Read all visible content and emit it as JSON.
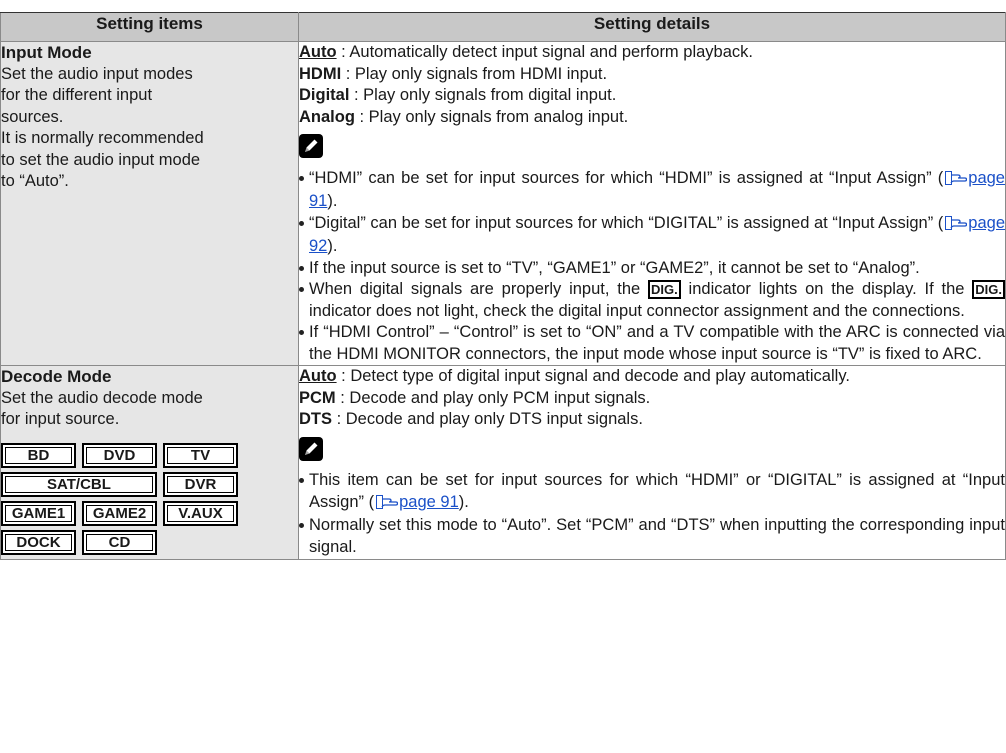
{
  "header": {
    "col1": "Setting items",
    "col2": "Setting details"
  },
  "input_mode": {
    "title": "Input Mode",
    "desc_lines": [
      "Set the audio input modes",
      "for the different input",
      "sources.",
      "It is normally recommended",
      "to set the audio input mode",
      "to “Auto”."
    ],
    "options": [
      {
        "name": "Auto",
        "desc": " : Automatically detect input signal and perform playback."
      },
      {
        "name": "HDMI",
        "desc": " : Play only signals from HDMI input."
      },
      {
        "name": "Digital",
        "desc": " : Play only signals from digital input."
      },
      {
        "name": "Analog",
        "desc": " : Play only signals from analog input."
      }
    ],
    "notes": {
      "n1_pre": "“HDMI” can be set for input sources for which “HDMI” is assigned at “Input Assign” (",
      "n1_link": "page 91",
      "n1_post": ").",
      "n2_pre": "“Digital” can be set for input sources for which “DIGITAL” is assigned at “Input Assign” (",
      "n2_link": "page 92",
      "n2_post": ").",
      "n3": "If the input source is set to “TV”, “GAME1” or “GAME2”, it cannot be set to “Analog”.",
      "n4_a": "When digital signals are properly input, the ",
      "n4_ind1": "DIG.",
      "n4_b": " indicator lights on the display. If the ",
      "n4_ind2": "DIG.",
      "n4_c": " indicator does not light, check the digital input connector assignment and the connections.",
      "n5": "If “HDMI Control” – “Control” is set to “ON” and a TV compatible with the ARC is connected via the HDMI MONITOR connectors, the input mode whose input source is “TV” is fixed to ARC."
    }
  },
  "decode_mode": {
    "title": "Decode Mode",
    "desc_lines": [
      "Set the  audio decode mode",
      "for input source."
    ],
    "sources": {
      "bd": "BD",
      "dvd": "DVD",
      "tv": "TV",
      "satcbl": "SAT/CBL",
      "dvr": "DVR",
      "game1": "GAME1",
      "game2": "GAME2",
      "vaux": "V.AUX",
      "dock": "DOCK",
      "cd": "CD"
    },
    "options": [
      {
        "name": "Auto",
        "desc": " : Detect type of digital input signal and decode and play automatically."
      },
      {
        "name": "PCM",
        "desc": " : Decode and play only PCM input signals."
      },
      {
        "name": "DTS",
        "desc": " : Decode and play only DTS input signals."
      }
    ],
    "notes": {
      "n1_pre": "This item can be set for input sources for which “HDMI” or “DIGITAL” is assigned at “Input Assign” (",
      "n1_link": "page 91",
      "n1_post": ").",
      "n2": "Normally set this mode to “Auto”. Set “PCM” and “DTS” when inputting the corresponding input signal."
    }
  }
}
